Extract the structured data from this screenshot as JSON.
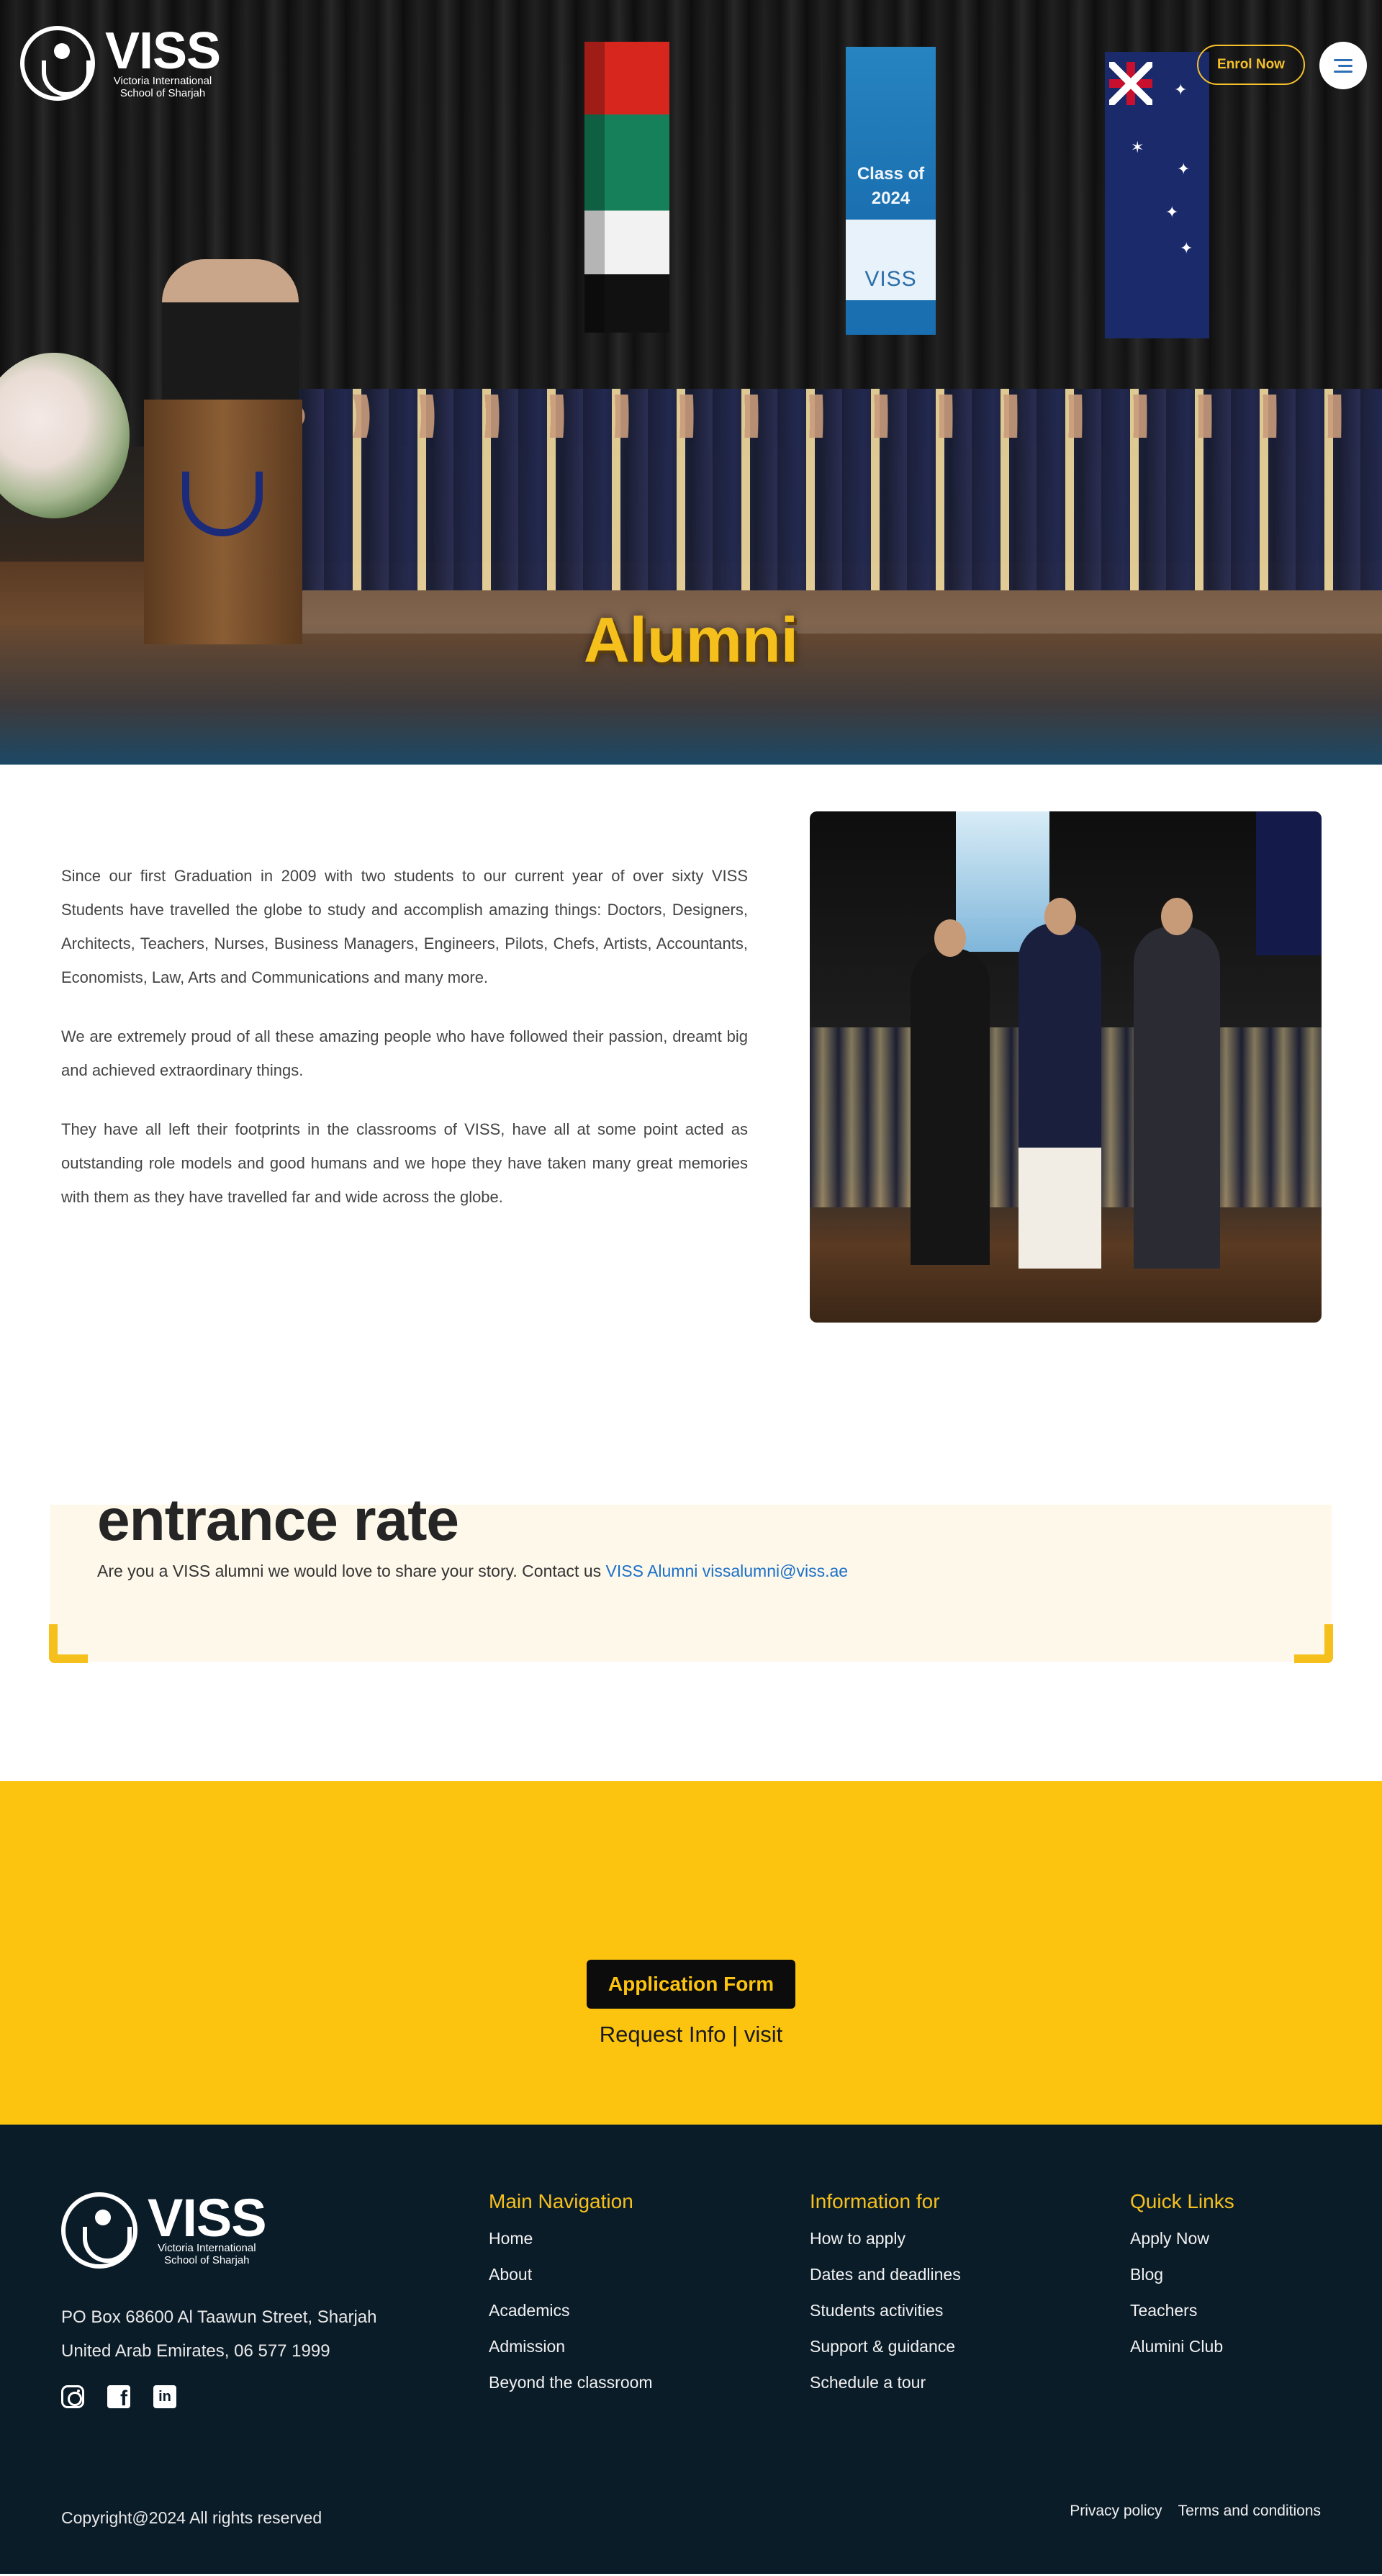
{
  "header": {
    "logo_word": "VISS",
    "logo_sub_line1": "Victoria International",
    "logo_sub_line2": "School of Sharjah",
    "enrol_label": "Enrol Now"
  },
  "hero": {
    "title": "Alumni",
    "banner_line1": "Class of",
    "banner_line2": "2024",
    "banner_logo": "VISS"
  },
  "intro": {
    "paragraphs": [
      "Since our first Graduation in 2009 with two students to our current year of over sixty VISS Students have travelled the globe to study and accomplish amazing things: Doctors, Designers, Architects, Teachers, Nurses, Business Managers, Engineers, Pilots, Chefs, Artists, Accountants, Economists, Law, Arts and Communications and many more.",
      "We are extremely proud of all these amazing people who have followed their passion, dreamt big and achieved extraordinary things.",
      "They have all left their footprints in the classrooms of VISS, have all at some point acted as outstanding role models and good humans and we hope they have taken many great memories with them as they have travelled far and wide across the globe."
    ]
  },
  "callout": {
    "heading": "entrance rate",
    "text": "Are you a VISS alumni we would love to share your story. Contact us",
    "link_text": "VISS Alumni vissalumni@viss.ae"
  },
  "cta": {
    "button_label": "Application Form",
    "request_info": "Request Info",
    "separator": "|",
    "visit": "visit"
  },
  "footer": {
    "address_line1": "PO Box 68600 Al Taawun Street, Sharjah",
    "address_line2": "United Arab Emirates, 06 577 1999",
    "columns": [
      {
        "title": "Main Navigation",
        "items": [
          "Home",
          "About",
          "Academics",
          "Admission",
          "Beyond the classroom"
        ]
      },
      {
        "title": "Information for",
        "items": [
          "How to apply",
          "Dates and deadlines",
          "Students activities",
          "Support & guidance",
          "Schedule a tour"
        ]
      },
      {
        "title": "Quick Links",
        "items": [
          "Apply Now",
          "Blog",
          "Teachers",
          "Alumini Club"
        ]
      }
    ],
    "copyright": "Copyright@2024 All rights reserved",
    "privacy": "Privacy policy",
    "terms": "Terms and conditions",
    "social_icons": [
      "instagram-icon",
      "facebook-icon",
      "linkedin-icon"
    ]
  },
  "colors": {
    "accent_yellow": "#f6c01c",
    "cta_background": "#fdc40f",
    "footer_background": "#0b1c29",
    "link_blue": "#1a6fc9"
  }
}
